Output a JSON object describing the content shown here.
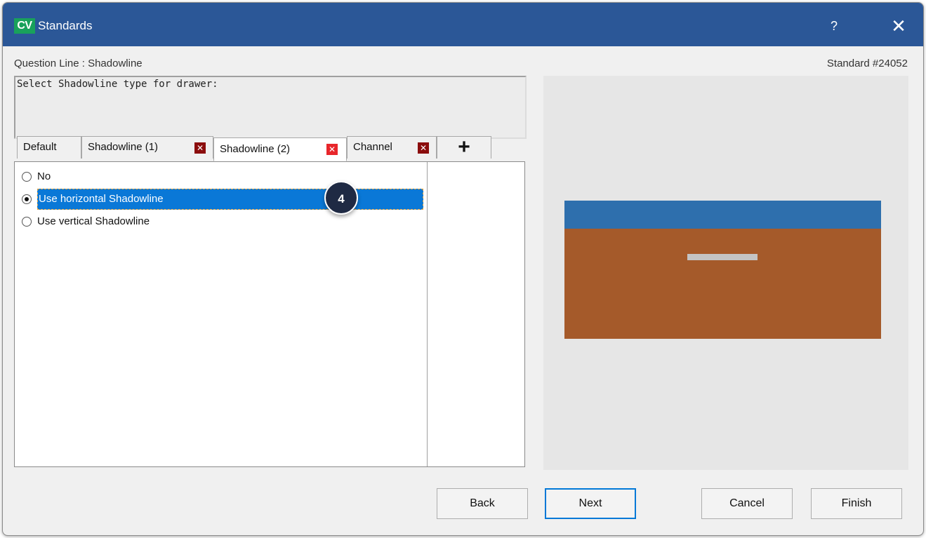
{
  "window": {
    "logo_text": "CV",
    "title": "Standards",
    "help_label": "?",
    "close_label": "✕"
  },
  "header": {
    "question_line": "Question Line : Shadowline",
    "standard_number": "Standard #24052"
  },
  "description": "Select Shadowline type for drawer:",
  "tabs": [
    {
      "label": "Default"
    },
    {
      "label": "Shadowline (1)",
      "remove_icon": "close-box-icon"
    },
    {
      "label": "Shadowline (2)",
      "remove_icon": "close-box-icon",
      "active": true
    },
    {
      "label": "Channel",
      "remove_icon": "close-box-icon"
    },
    {
      "label": "+",
      "icon": "plus-icon"
    }
  ],
  "tab_remove_glyph": "✕",
  "options": [
    {
      "label": "No",
      "checked": false
    },
    {
      "label": "Use horizontal Shadowline",
      "checked": true,
      "selected": true
    },
    {
      "label": "Use vertical Shadowline",
      "checked": false
    }
  ],
  "callout": "4",
  "preview": {
    "colors": {
      "drawer_top": "#2e6fad",
      "drawer_front": "#a55a2a",
      "shadowline": "#c4c4c4"
    }
  },
  "buttons": {
    "back": "Back",
    "next": "Next",
    "cancel": "Cancel",
    "finish": "Finish"
  },
  "colors": {
    "titlebar": "#2b5797",
    "selection": "#0a78d7",
    "logo_bg": "#19a15b"
  }
}
